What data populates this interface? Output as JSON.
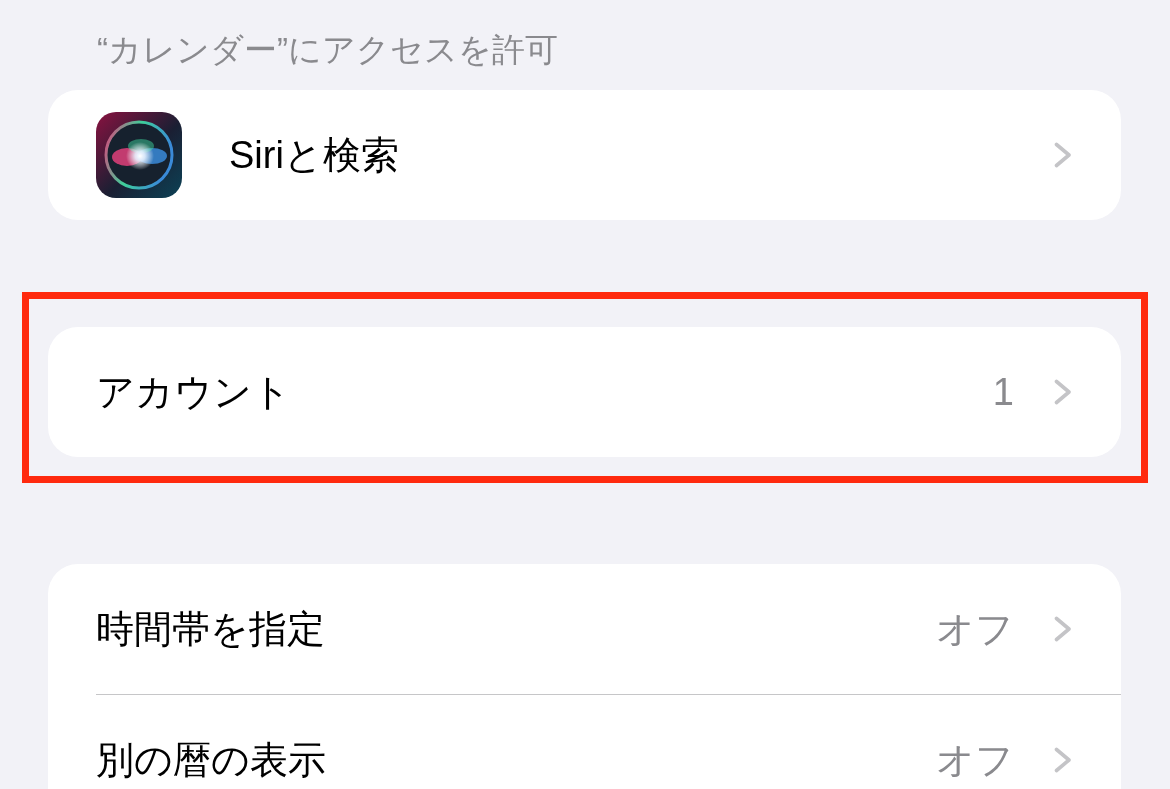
{
  "header": "“カレンダー”にアクセスを許可",
  "groups": [
    {
      "highlighted": false,
      "rows": [
        {
          "kind": "app",
          "label": "Siriと検索"
        }
      ]
    },
    {
      "highlighted": true,
      "rows": [
        {
          "kind": "value",
          "label": "アカウント",
          "value": "1"
        }
      ]
    },
    {
      "highlighted": false,
      "rows": [
        {
          "kind": "value",
          "label": "時間帯を指定",
          "value": "オフ"
        },
        {
          "kind": "value",
          "label": "別の暦の表示",
          "value": "オフ"
        }
      ]
    }
  ]
}
